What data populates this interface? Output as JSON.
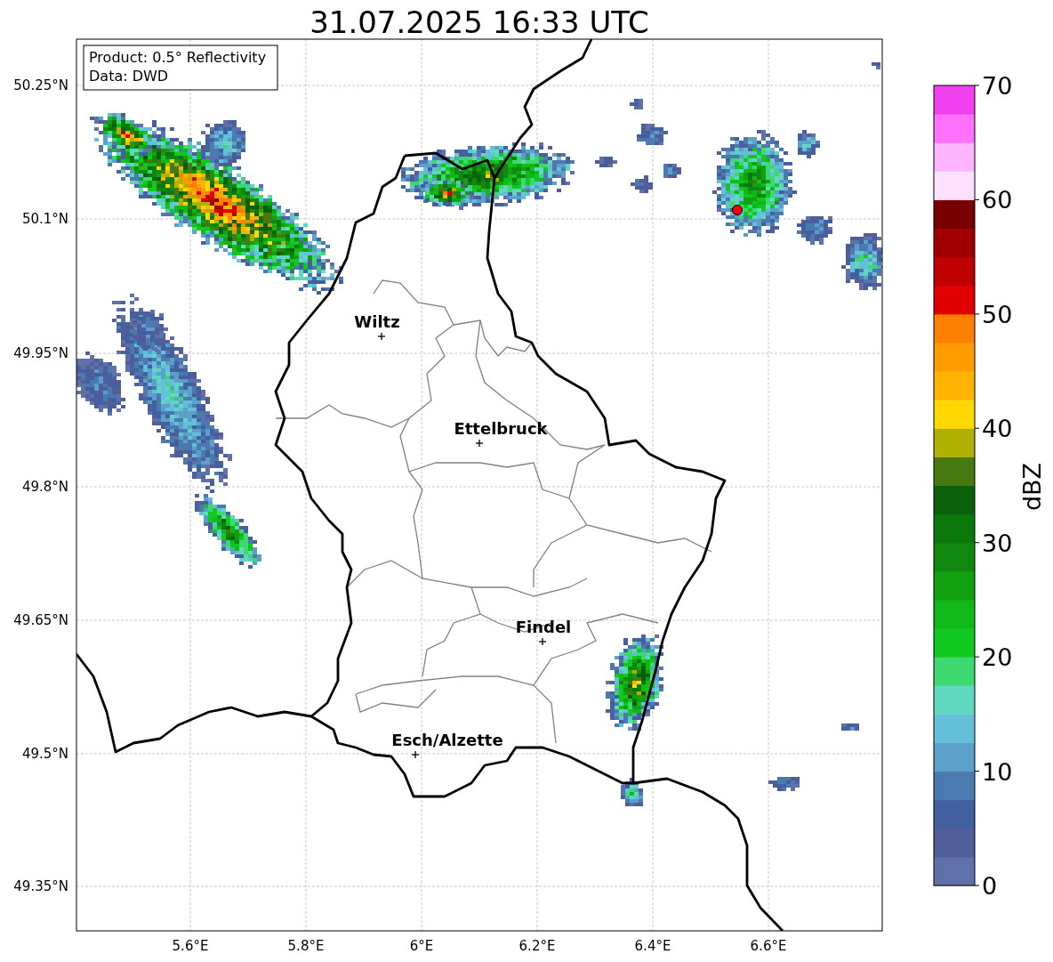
{
  "title": "31.07.2025 16:33 UTC",
  "legend": [
    "Product: 0.5° Reflectivity",
    "Data: DWD"
  ],
  "y_ticks": [
    "50.25°N",
    "50.1°N",
    "49.95°N",
    "49.8°N",
    "49.65°N",
    "49.5°N",
    "49.35°N"
  ],
  "x_ticks": [
    "5.6°E",
    "5.8°E",
    "6°E",
    "6.2°E",
    "6.4°E",
    "6.6°E"
  ],
  "cities": [
    {
      "name": "Wiltz"
    },
    {
      "name": "Ettelbruck"
    },
    {
      "name": "Findel"
    },
    {
      "name": "Esch/Alzette"
    }
  ],
  "colorbar": {
    "label": "dBZ",
    "ticks": [
      "70",
      "60",
      "50",
      "40",
      "30",
      "20",
      "10",
      "0"
    ],
    "segments": [
      {
        "color": "#6070a8"
      },
      {
        "color": "#505f9a"
      },
      {
        "color": "#4260a0"
      },
      {
        "color": "#4a7ab0"
      },
      {
        "color": "#5aa0c8"
      },
      {
        "color": "#64c0d8"
      },
      {
        "color": "#60d8c0"
      },
      {
        "color": "#3cd870"
      },
      {
        "color": "#10c820"
      },
      {
        "color": "#10b818"
      },
      {
        "color": "#10a010"
      },
      {
        "color": "#108810"
      },
      {
        "color": "#0a780a"
      },
      {
        "color": "#0a600a"
      },
      {
        "color": "#487810"
      },
      {
        "color": "#b0b000"
      },
      {
        "color": "#ffd800"
      },
      {
        "color": "#ffb400"
      },
      {
        "color": "#ff9c00"
      },
      {
        "color": "#ff8000"
      },
      {
        "color": "#e00000"
      },
      {
        "color": "#c00000"
      },
      {
        "color": "#a00000"
      },
      {
        "color": "#780000"
      },
      {
        "color": "#ffe0ff"
      },
      {
        "color": "#ffb4ff"
      },
      {
        "color": "#ff70ff"
      },
      {
        "color": "#f040f0"
      }
    ]
  }
}
